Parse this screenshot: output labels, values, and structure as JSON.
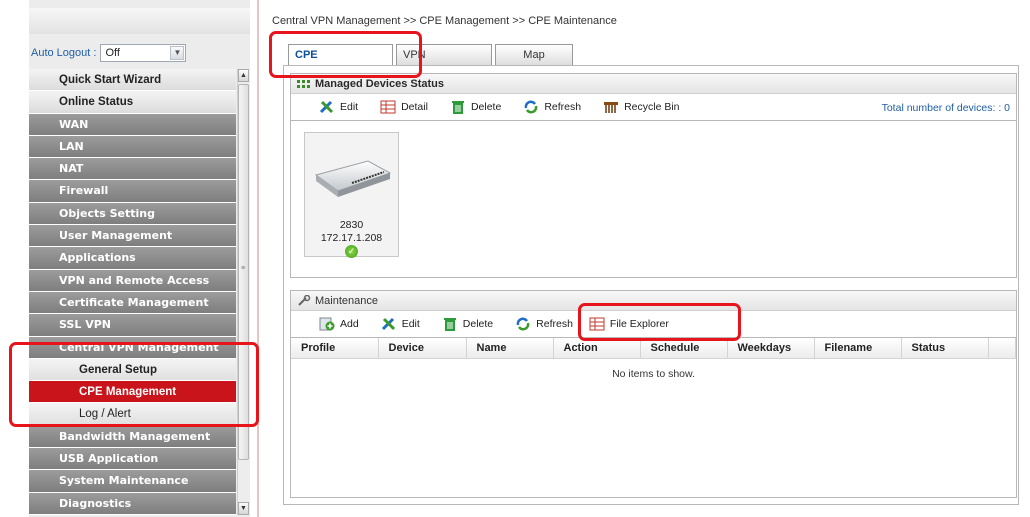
{
  "sidebar": {
    "autologout_label": "Auto Logout :",
    "autologout_value": "Off",
    "menu": [
      {
        "label": "Quick Start Wizard",
        "style": "light"
      },
      {
        "label": "Online Status",
        "style": "light"
      },
      {
        "label": "WAN",
        "style": "dark"
      },
      {
        "label": "LAN",
        "style": "dark"
      },
      {
        "label": "NAT",
        "style": "dark"
      },
      {
        "label": "Firewall",
        "style": "dark"
      },
      {
        "label": "Objects Setting",
        "style": "dark"
      },
      {
        "label": "User Management",
        "style": "dark"
      },
      {
        "label": "Applications",
        "style": "dark"
      },
      {
        "label": "VPN and Remote Access",
        "style": "dark"
      },
      {
        "label": "Certificate Management",
        "style": "dark"
      },
      {
        "label": "SSL VPN",
        "style": "dark"
      },
      {
        "label": "Central VPN Management",
        "style": "dark"
      },
      {
        "label": "General Setup",
        "style": "sub"
      },
      {
        "label": "CPE Management",
        "style": "sub active"
      },
      {
        "label": "Log / Alert",
        "style": "sub plain"
      },
      {
        "label": "Bandwidth Management",
        "style": "dark"
      },
      {
        "label": "USB Application",
        "style": "dark"
      },
      {
        "label": "System Maintenance",
        "style": "dark"
      },
      {
        "label": "Diagnostics",
        "style": "dark"
      }
    ]
  },
  "breadcrumb": "Central VPN Management >> CPE Management >> CPE Maintenance",
  "tabs": [
    "CPE Maintenance",
    "VPN Management",
    "Map"
  ],
  "managed": {
    "title": "Managed Devices Status",
    "toolbar": [
      "Edit",
      "Detail",
      "Delete",
      "Refresh",
      "Recycle Bin"
    ],
    "total_label": "Total number of devices: : 0",
    "device": {
      "name": "2830",
      "ip": "172.17.1.208"
    }
  },
  "maintenance": {
    "title": "Maintenance",
    "toolbar": [
      "Add",
      "Edit",
      "Delete",
      "Refresh",
      "File Explorer"
    ],
    "columns": [
      "Profile",
      "Device",
      "Name",
      "Action",
      "Schedule",
      "Weekdays",
      "Filename",
      "Status"
    ],
    "empty_text": "No items to show."
  },
  "colors": {
    "accent_red": "#c8141a",
    "highlight": "#e8141c",
    "link_blue": "#1f5fa5"
  }
}
